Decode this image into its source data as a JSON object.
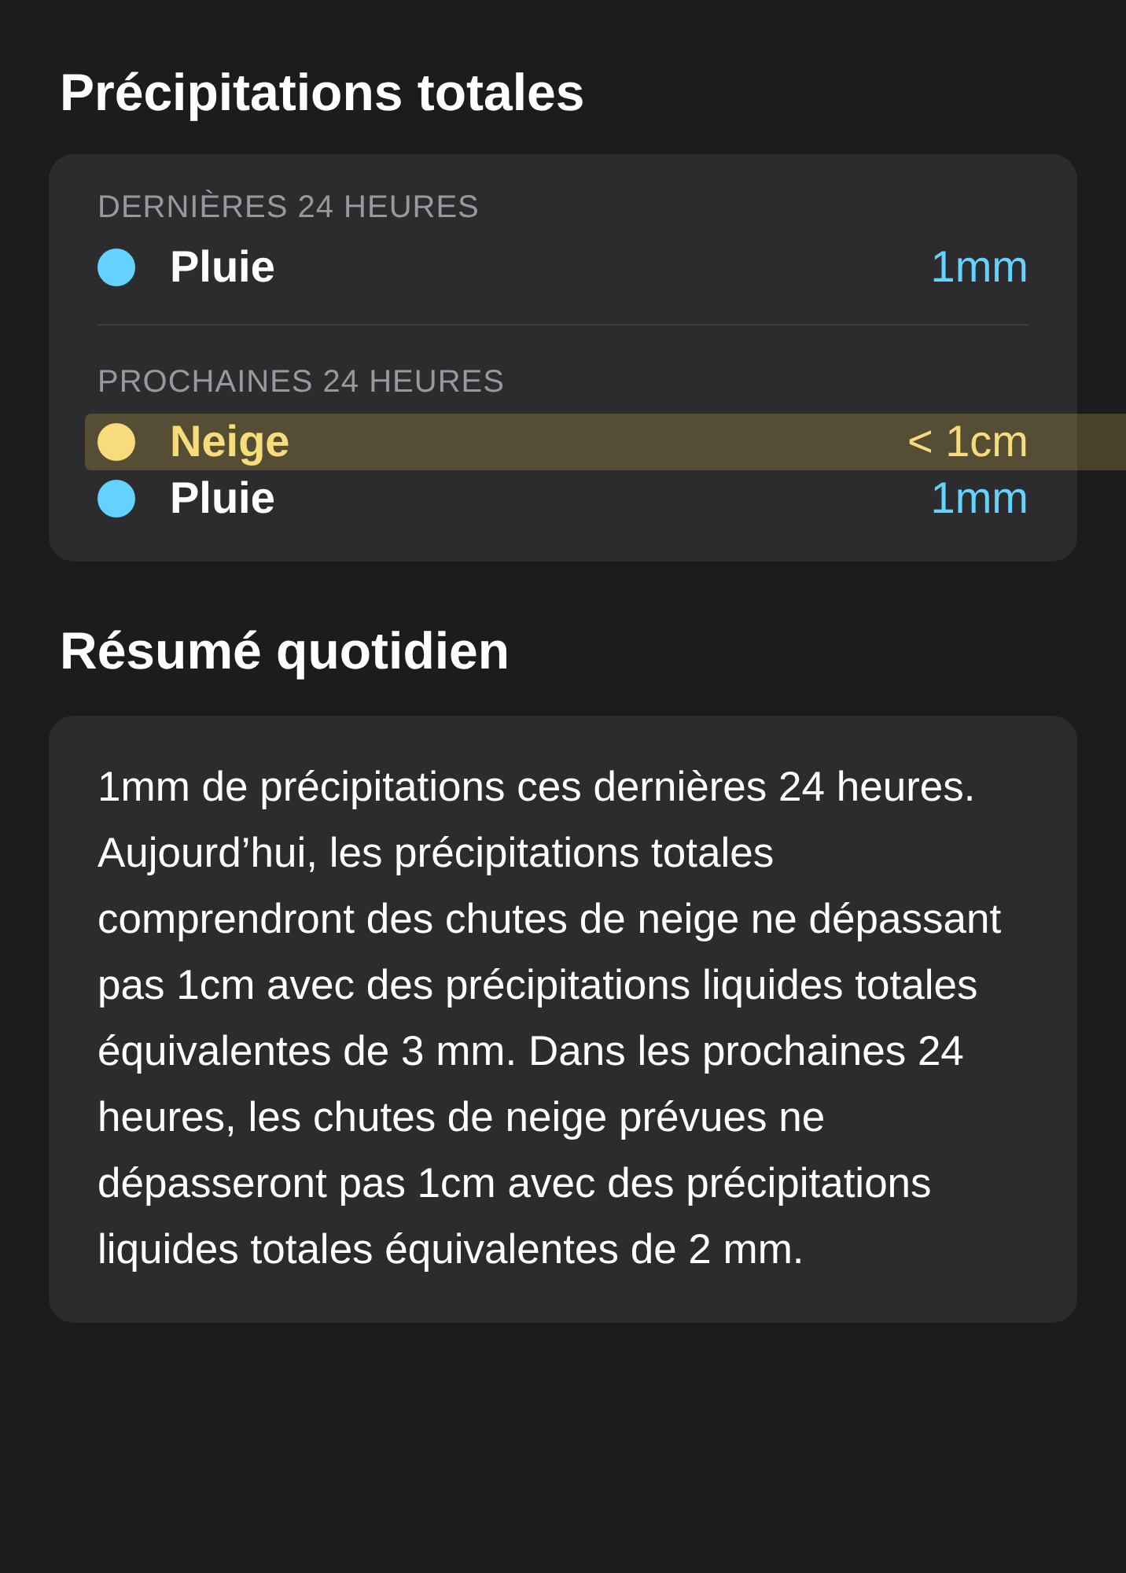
{
  "precipitation": {
    "title": "Précipitations totales",
    "sections": [
      {
        "heading": "DERNIÈRES 24 HEURES",
        "rows": [
          {
            "label": "Pluie",
            "amount": "1mm",
            "color": "#64d2ff",
            "selected": false
          }
        ]
      },
      {
        "heading": "PROCHAINES 24 HEURES",
        "rows": [
          {
            "label": "Neige",
            "amount": "< 1cm",
            "color": "#f7dc7c",
            "selected": true
          },
          {
            "label": "Pluie",
            "amount": "1mm",
            "color": "#64d2ff",
            "selected": false
          }
        ]
      }
    ]
  },
  "summary": {
    "title": "Résumé quotidien",
    "text": "1mm de précipitations ces dernières 24 heures. Aujourd’hui, les précipitations totales comprendront des chutes de neige ne dépassant pas 1cm avec des précipitations liquides totales équivalentes de 3 mm. Dans les prochaines 24 heures, les chutes de neige prévues ne dépasseront pas 1cm avec des précipitations liquides totales équivalentes de 2 mm."
  }
}
